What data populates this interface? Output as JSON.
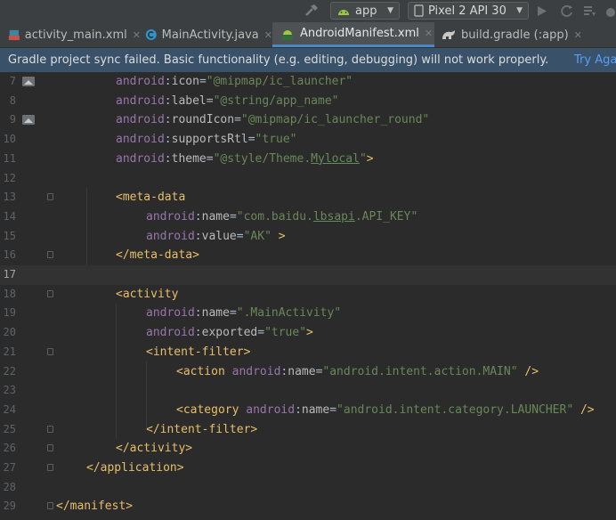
{
  "toolbar": {
    "config_label": "app",
    "device_label": "Pixel 2 API 30",
    "colors": {
      "run_config_icon": "#9aca3f"
    }
  },
  "tabs": [
    {
      "label": "activity_main.xml",
      "icon": "xml-layout-icon",
      "active": false
    },
    {
      "label": "MainActivity.java",
      "icon": "java-class-icon",
      "active": false
    },
    {
      "label": "AndroidManifest.xml",
      "icon": "manifest-icon",
      "active": true
    },
    {
      "label": "build.gradle (:app)",
      "icon": "gradle-icon",
      "active": false
    }
  ],
  "notification": {
    "message": "Gradle project sync failed. Basic functionality (e.g. editing, debugging) will not work properly.",
    "action": "Try Aga"
  },
  "editor": {
    "current_line": "17",
    "lines": [
      {
        "n": "7",
        "gutter_icon": "image-icon",
        "fold": ""
      },
      {
        "n": "8",
        "gutter_icon": "",
        "fold": ""
      },
      {
        "n": "9",
        "gutter_icon": "image-icon",
        "fold": ""
      },
      {
        "n": "10",
        "gutter_icon": "",
        "fold": ""
      },
      {
        "n": "11",
        "gutter_icon": "",
        "fold": ""
      },
      {
        "n": "12",
        "gutter_icon": "",
        "fold": ""
      },
      {
        "n": "13",
        "gutter_icon": "",
        "fold": "open"
      },
      {
        "n": "14",
        "gutter_icon": "",
        "fold": ""
      },
      {
        "n": "15",
        "gutter_icon": "",
        "fold": ""
      },
      {
        "n": "16",
        "gutter_icon": "",
        "fold": "close"
      },
      {
        "n": "17",
        "gutter_icon": "",
        "fold": ""
      },
      {
        "n": "18",
        "gutter_icon": "",
        "fold": "open"
      },
      {
        "n": "19",
        "gutter_icon": "",
        "fold": ""
      },
      {
        "n": "20",
        "gutter_icon": "",
        "fold": ""
      },
      {
        "n": "21",
        "gutter_icon": "",
        "fold": "open"
      },
      {
        "n": "22",
        "gutter_icon": "",
        "fold": ""
      },
      {
        "n": "23",
        "gutter_icon": "",
        "fold": ""
      },
      {
        "n": "24",
        "gutter_icon": "",
        "fold": ""
      },
      {
        "n": "25",
        "gutter_icon": "",
        "fold": "close"
      },
      {
        "n": "26",
        "gutter_icon": "",
        "fold": "close"
      },
      {
        "n": "27",
        "gutter_icon": "",
        "fold": "close"
      },
      {
        "n": "28",
        "gutter_icon": "",
        "fold": ""
      },
      {
        "n": "29",
        "gutter_icon": "",
        "fold": "close"
      }
    ],
    "tokens": {
      "l7": {
        "ns": "android",
        "attr": "icon",
        "val": "\"@mipmap/ic_launcher\""
      },
      "l8": {
        "ns": "android",
        "attr": "label",
        "val": "\"@string/app_name\""
      },
      "l9": {
        "ns": "android",
        "attr": "roundIcon",
        "val": "\"@mipmap/ic_launcher_round\""
      },
      "l10": {
        "ns": "android",
        "attr": "supportsRtl",
        "val": "\"true\""
      },
      "l11": {
        "ns": "android",
        "attr": "theme",
        "val_a": "\"@style/Theme.",
        "val_b": "Mylocal",
        "val_c": "\"",
        "close": ">"
      },
      "l13": {
        "tag": "<meta-data"
      },
      "l14": {
        "ns": "android",
        "attr": "name",
        "val_a": "\"com.baidu.",
        "val_b": "lbsapi",
        "val_c": ".API_KEY\""
      },
      "l15": {
        "ns": "android",
        "attr": "value",
        "val": "\"AK\"",
        "close": " >"
      },
      "l16": {
        "tag": "</meta-data>"
      },
      "l18": {
        "tag": "<activity"
      },
      "l19": {
        "ns": "android",
        "attr": "name",
        "val": "\".MainActivity\""
      },
      "l20": {
        "ns": "android",
        "attr": "exported",
        "val": "\"true\"",
        "close": ">"
      },
      "l21": {
        "tag": "<intent-filter>"
      },
      "l22": {
        "tag": "<action ",
        "ns": "android",
        "attr": "name",
        "val": "\"android.intent.action.MAIN\"",
        "close": " />"
      },
      "l24": {
        "tag": "<category ",
        "ns": "android",
        "attr": "name",
        "val": "\"android.intent.category.LAUNCHER\"",
        "close": " />"
      },
      "l25": {
        "tag": "</intent-filter>"
      },
      "l26": {
        "tag": "</activity>"
      },
      "l27": {
        "tag": "</application>"
      },
      "l29": {
        "tag": "</manifest>"
      },
      "colon": ":",
      "eq": "="
    }
  }
}
